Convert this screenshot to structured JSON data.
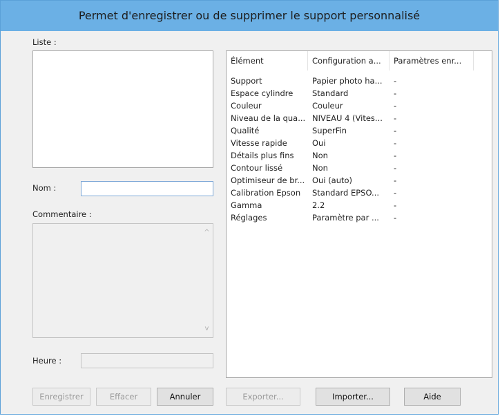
{
  "window": {
    "title": "Permet d'enregistrer ou de supprimer le support personnalisé"
  },
  "left": {
    "list_label": "Liste :",
    "name_label": "Nom :",
    "name_value": "",
    "comment_label": "Commentaire :",
    "comment_value": "",
    "time_label": "Heure :",
    "time_value": ""
  },
  "table": {
    "headers": [
      "Élément",
      "Configuration a...",
      "Paramètres enr..."
    ],
    "rows": [
      [
        "Support",
        "Papier photo ha...",
        "-"
      ],
      [
        "Espace cylindre",
        "Standard",
        "-"
      ],
      [
        "Couleur",
        "Couleur",
        "-"
      ],
      [
        "Niveau de la qua...",
        "NIVEAU 4 (Vites...",
        "-"
      ],
      [
        "Qualité",
        "SuperFin",
        "-"
      ],
      [
        "Vitesse rapide",
        "Oui",
        "-"
      ],
      [
        "Détails plus fins",
        "Non",
        "-"
      ],
      [
        "Contour lissé",
        "Non",
        "-"
      ],
      [
        "Optimiseur de br...",
        "Oui (auto)",
        "-"
      ],
      [
        "Calibration Epson",
        "Standard EPSO...",
        "-"
      ],
      [
        "Gamma",
        "2.2",
        "-"
      ],
      [
        "Réglages",
        "Paramètre par ...",
        "-"
      ]
    ]
  },
  "buttons": {
    "save": "Enregistrer",
    "delete": "Effacer",
    "cancel": "Annuler",
    "export": "Exporter...",
    "import": "Importer...",
    "help": "Aide"
  },
  "icons": {
    "scroll_up": "scroll-up-arrow-icon",
    "scroll_down": "scroll-down-arrow-icon"
  }
}
